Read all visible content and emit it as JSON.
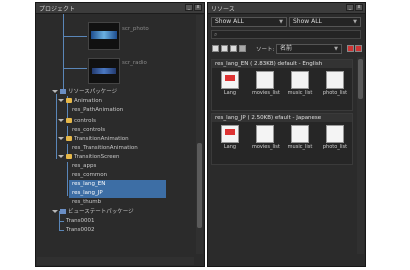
{
  "project_panel": {
    "title": "プロジェクト",
    "thumbnails": [
      {
        "label": "scr_photo"
      },
      {
        "label": "scr_radio"
      }
    ],
    "tree": [
      {
        "label": "リソースパッケージ"
      },
      {
        "label": "Animation"
      },
      {
        "label": "res_PathAnimation"
      },
      {
        "label": "controls"
      },
      {
        "label": "res_controls"
      },
      {
        "label": "TransitionAnimation"
      },
      {
        "label": "res_TransitionAnimation"
      },
      {
        "label": "TransitionScreen"
      },
      {
        "label": "res_apps"
      },
      {
        "label": "res_common"
      },
      {
        "label": "res_lang_EN"
      },
      {
        "label": "res_lang_JP"
      },
      {
        "label": "res_thumb"
      },
      {
        "label": "ビューステートパッケージ"
      },
      {
        "label": "Trans0001"
      },
      {
        "label": "Trans0002"
      }
    ],
    "selected": [
      "res_lang_EN",
      "res_lang_JP"
    ]
  },
  "resource_panel": {
    "title": "リソース",
    "filter1": "Show ALL",
    "filter2": "Show ALL",
    "sort_label": "ソート:",
    "sort_value": "名前",
    "groups": [
      {
        "header": "res_lang_EN   ( 2.83KB) default - English",
        "items": [
          "Lang",
          "movies_list",
          "music_list",
          "photo_list"
        ]
      },
      {
        "header": "res_lang_JP   ( 2.50KB) efault - Japanese",
        "items": [
          "Lang",
          "movies_list",
          "music_list",
          "photo_list"
        ]
      }
    ]
  },
  "colors": {
    "panel_bg": "#2b2b2b",
    "selection": "#3d6ea5",
    "tree_line": "#5a86b8",
    "folder": "#e6b84a"
  }
}
